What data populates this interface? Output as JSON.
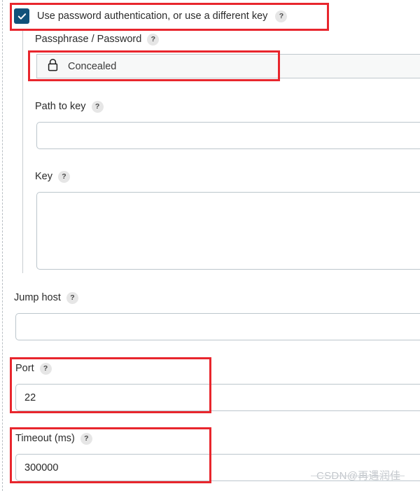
{
  "form": {
    "password_auth": {
      "label": "Use password authentication, or use a different key",
      "checked": true,
      "checkbox_color": "#11527a",
      "help": "?"
    },
    "passphrase": {
      "label": "Passphrase / Password",
      "help": "?",
      "value": "Concealed",
      "icon": "lock-icon"
    },
    "path_to_key": {
      "label": "Path to key",
      "help": "?",
      "value": "",
      "placeholder": ""
    },
    "key": {
      "label": "Key",
      "help": "?",
      "value": "",
      "placeholder": ""
    },
    "jump_host": {
      "label": "Jump host",
      "help": "?",
      "value": "",
      "placeholder": ""
    },
    "port": {
      "label": "Port",
      "help": "?",
      "value": "22",
      "placeholder": ""
    },
    "timeout": {
      "label": "Timeout (ms)",
      "help": "?",
      "value": "300000",
      "placeholder": ""
    }
  },
  "annotations": {
    "color": "#e8262d",
    "boxes": [
      "password-auth-checkbox-row",
      "passphrase-concealed-field",
      "port-field-group",
      "timeout-field-group"
    ]
  },
  "watermark": {
    "text": "CSDN@再遇润佳"
  }
}
